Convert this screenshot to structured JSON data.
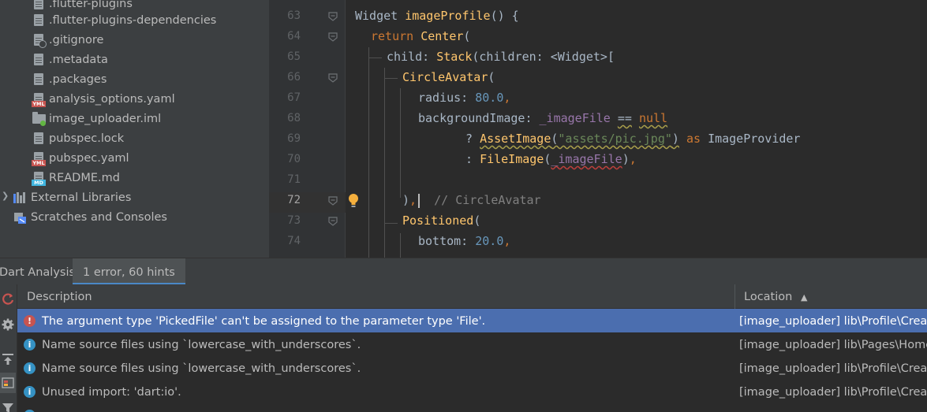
{
  "project_tree": {
    "items": [
      {
        "label": ".flutter-plugins",
        "icon": "file-icon"
      },
      {
        "label": ".flutter-plugins-dependencies",
        "icon": "file-icon"
      },
      {
        "label": ".gitignore",
        "icon": "ignore-file-icon"
      },
      {
        "label": ".metadata",
        "icon": "file-icon"
      },
      {
        "label": ".packages",
        "icon": "file-icon"
      },
      {
        "label": "analysis_options.yaml",
        "icon": "yaml-file-icon"
      },
      {
        "label": "image_uploader.iml",
        "icon": "module-file-icon"
      },
      {
        "label": "pubspec.lock",
        "icon": "file-icon"
      },
      {
        "label": "pubspec.yaml",
        "icon": "yaml-file-icon"
      },
      {
        "label": "README.md",
        "icon": "markdown-file-icon"
      },
      {
        "label": "External Libraries",
        "icon": "libraries-icon"
      },
      {
        "label": "Scratches and Consoles",
        "icon": "scratches-icon"
      }
    ],
    "file_tags": {
      "yaml": "YML",
      "markdown": "MD"
    }
  },
  "editor": {
    "line_numbers": [
      "63",
      "64",
      "65",
      "66",
      "67",
      "68",
      "69",
      "70",
      "71",
      "72",
      "73",
      "74"
    ],
    "current_line": "72",
    "lines": [
      {
        "tokens": [
          {
            "t": "Widget ",
            "c": "prop"
          },
          {
            "t": "imageProfile",
            "c": "fn"
          },
          {
            "t": "() {",
            "c": "prop"
          }
        ]
      },
      {
        "tokens": [
          {
            "t": "return ",
            "c": "kw"
          },
          {
            "t": "Center",
            "c": "cls"
          },
          {
            "t": "(",
            "c": "prop"
          }
        ]
      },
      {
        "tokens": [
          {
            "t": "child: ",
            "c": "prop"
          },
          {
            "t": "Stack",
            "c": "cls"
          },
          {
            "t": "(children: <Widget>[",
            "c": "prop"
          }
        ]
      },
      {
        "tokens": [
          {
            "t": "CircleAvatar",
            "c": "cls"
          },
          {
            "t": "(",
            "c": "prop"
          }
        ]
      },
      {
        "tokens": [
          {
            "t": "radius: ",
            "c": "prop"
          },
          {
            "t": "80.0",
            "c": "num"
          },
          {
            "t": ",",
            "c": "kw"
          }
        ]
      },
      {
        "tokens": [
          {
            "t": "backgroundImage: ",
            "c": "prop"
          },
          {
            "t": "_imageFile",
            "c": "fld"
          },
          {
            "t": " ",
            "c": "prop"
          },
          {
            "t": "==",
            "c": "prop wavy-y"
          },
          {
            "t": " ",
            "c": "prop"
          },
          {
            "t": "null",
            "c": "kw wavy-y"
          }
        ]
      },
      {
        "tokens": [
          {
            "t": "? ",
            "c": "prop"
          },
          {
            "t": "AssetImage",
            "c": "cls wavy-y"
          },
          {
            "t": "(",
            "c": "prop wavy-y"
          },
          {
            "t": "\"assets/pic.jpg\"",
            "c": "str wavy-y"
          },
          {
            "t": ")",
            "c": "prop wavy-y"
          },
          {
            "t": " as ",
            "c": "kw"
          },
          {
            "t": "ImageProvider",
            "c": "prop"
          }
        ]
      },
      {
        "tokens": [
          {
            "t": ": ",
            "c": "prop"
          },
          {
            "t": "FileImage",
            "c": "cls"
          },
          {
            "t": "(",
            "c": "prop"
          },
          {
            "t": "_imageFile",
            "c": "fld wavy"
          },
          {
            "t": ")",
            "c": "prop"
          },
          {
            "t": ",",
            "c": "kw"
          }
        ]
      },
      {
        "tokens": []
      },
      {
        "tokens": [
          {
            "t": ")",
            "c": "prop"
          },
          {
            "t": ",",
            "c": "kw"
          },
          {
            "t": "",
            "c": "caret"
          },
          {
            "t": "  // CircleAvatar",
            "c": "cmt"
          }
        ]
      },
      {
        "tokens": [
          {
            "t": "Positioned",
            "c": "cls"
          },
          {
            "t": "(",
            "c": "prop"
          }
        ]
      },
      {
        "tokens": [
          {
            "t": "bottom: ",
            "c": "prop"
          },
          {
            "t": "20.0",
            "c": "num"
          },
          {
            "t": ",",
            "c": "kw"
          }
        ]
      }
    ]
  },
  "problems_panel": {
    "tabs": [
      {
        "label": "Dart Analysis"
      },
      {
        "label": "1 error, 60 hints"
      }
    ],
    "columns": {
      "description": "Description",
      "location": "Location"
    },
    "sort_indicator": "▲",
    "rows": [
      {
        "severity": "error",
        "icon_glyph": "!",
        "description": "The argument type 'PickedFile' can't be assigned to the parameter type 'File'.",
        "location": "[image_uploader] lib\\Profile\\CreateI"
      },
      {
        "severity": "info",
        "icon_glyph": "i",
        "description": "Name source files using `lowercase_with_underscores`.",
        "location": "[image_uploader] lib\\Pages\\HomeP"
      },
      {
        "severity": "info",
        "icon_glyph": "i",
        "description": "Name source files using `lowercase_with_underscores`.",
        "location": "[image_uploader] lib\\Profile\\CreateI"
      },
      {
        "severity": "info",
        "icon_glyph": "i",
        "description": "Unused import: 'dart:io'.",
        "location": "[image_uploader] lib\\Profile\\CreateI"
      }
    ]
  },
  "colors": {
    "selection": "#4b6eaf",
    "error": "#c75450",
    "info": "#3592c4",
    "keyword": "#cc7832",
    "function": "#ffc66d",
    "number": "#6897bb",
    "string": "#6a8759",
    "field": "#9876aa"
  }
}
